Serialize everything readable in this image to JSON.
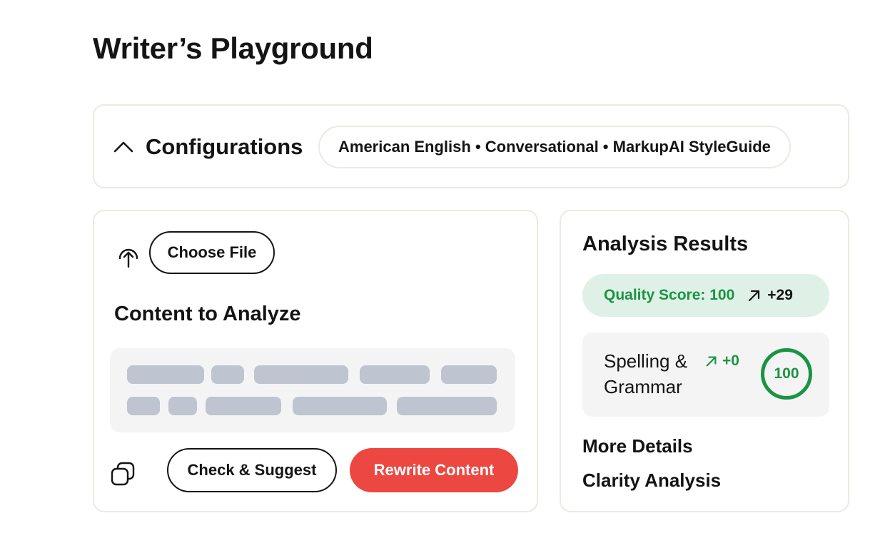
{
  "page": {
    "title": "Writer’s Playground"
  },
  "configurations": {
    "title": "Configurations",
    "summary": "American English • Conversational • MarkupAI StyleGuide",
    "toggle_icon": "chevron-up-icon"
  },
  "content": {
    "choose_file_label": "Choose File",
    "upload_icon": "upload-icon",
    "title": "Content to Analyze",
    "copy_icon": "copy-icon",
    "check_label": "Check & Suggest",
    "rewrite_label": "Rewrite Content"
  },
  "analysis": {
    "title": "Analysis Results",
    "quality_label": "Quality Score: 100",
    "quality_delta": "+29",
    "spelling_label": "Spelling & Grammar",
    "spelling_delta": "+0",
    "spelling_score": "100",
    "more_details": "More Details",
    "clarity": "Clarity Analysis"
  },
  "colors": {
    "accent_green": "#1a9444",
    "quality_bg": "#dff1e6",
    "rewrite_red": "#ec4741",
    "skeleton": "#bec4d0",
    "card_border": "#ebeae3"
  }
}
